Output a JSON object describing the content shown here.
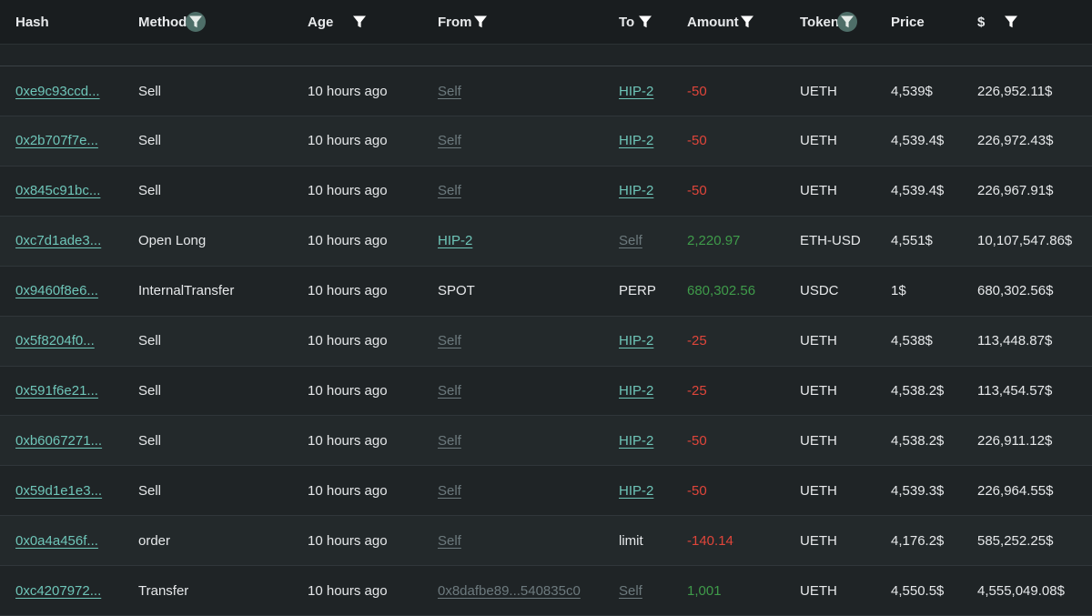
{
  "colors": {
    "link": "#6ec5b8",
    "negative": "#e0453a",
    "positive": "#3f9b4a",
    "muted": "#6d7a7e",
    "filter_active_bg": "#4e6e68"
  },
  "columns": [
    {
      "label": "Hash",
      "filter": "none"
    },
    {
      "label": "Method",
      "filter": "active"
    },
    {
      "label": "Age",
      "filter": "plain"
    },
    {
      "label": "From",
      "filter": "plain"
    },
    {
      "label": "To",
      "filter": "plain"
    },
    {
      "label": "Amount",
      "filter": "plain"
    },
    {
      "label": "Token",
      "filter": "active"
    },
    {
      "label": "Price",
      "filter": "none"
    },
    {
      "label": "$",
      "filter": "plain"
    }
  ],
  "rows": [
    {
      "hash": "0xe9c93ccd...",
      "method": "Sell",
      "age": "10 hours ago",
      "from": "Self",
      "from_style": "muted",
      "to": "HIP-2",
      "to_style": "link",
      "amount": "-50",
      "amount_sign": "neg",
      "token": "UETH",
      "price": "4,539$",
      "usd": "226,952.11$"
    },
    {
      "hash": "0x2b707f7e...",
      "method": "Sell",
      "age": "10 hours ago",
      "from": "Self",
      "from_style": "muted",
      "to": "HIP-2",
      "to_style": "link",
      "amount": "-50",
      "amount_sign": "neg",
      "token": "UETH",
      "price": "4,539.4$",
      "usd": "226,972.43$"
    },
    {
      "hash": "0x845c91bc...",
      "method": "Sell",
      "age": "10 hours ago",
      "from": "Self",
      "from_style": "muted",
      "to": "HIP-2",
      "to_style": "link",
      "amount": "-50",
      "amount_sign": "neg",
      "token": "UETH",
      "price": "4,539.4$",
      "usd": "226,967.91$"
    },
    {
      "hash": "0xc7d1ade3...",
      "method": "Open Long",
      "age": "10 hours ago",
      "from": "HIP-2",
      "from_style": "link",
      "to": "Self",
      "to_style": "muted",
      "amount": "2,220.97",
      "amount_sign": "pos",
      "token": "ETH-USD",
      "price": "4,551$",
      "usd": "10,107,547.86$"
    },
    {
      "hash": "0x9460f8e6...",
      "method": "InternalTransfer",
      "age": "10 hours ago",
      "from": "SPOT",
      "from_style": "plain",
      "to": "PERP",
      "to_style": "plain",
      "amount": "680,302.56",
      "amount_sign": "pos",
      "token": "USDC",
      "price": "1$",
      "usd": "680,302.56$"
    },
    {
      "hash": "0x5f8204f0...",
      "method": "Sell",
      "age": "10 hours ago",
      "from": "Self",
      "from_style": "muted",
      "to": "HIP-2",
      "to_style": "link",
      "amount": "-25",
      "amount_sign": "neg",
      "token": "UETH",
      "price": "4,538$",
      "usd": "113,448.87$"
    },
    {
      "hash": "0x591f6e21...",
      "method": "Sell",
      "age": "10 hours ago",
      "from": "Self",
      "from_style": "muted",
      "to": "HIP-2",
      "to_style": "link",
      "amount": "-25",
      "amount_sign": "neg",
      "token": "UETH",
      "price": "4,538.2$",
      "usd": "113,454.57$"
    },
    {
      "hash": "0xb6067271...",
      "method": "Sell",
      "age": "10 hours ago",
      "from": "Self",
      "from_style": "muted",
      "to": "HIP-2",
      "to_style": "link",
      "amount": "-50",
      "amount_sign": "neg",
      "token": "UETH",
      "price": "4,538.2$",
      "usd": "226,911.12$"
    },
    {
      "hash": "0x59d1e1e3...",
      "method": "Sell",
      "age": "10 hours ago",
      "from": "Self",
      "from_style": "muted",
      "to": "HIP-2",
      "to_style": "link",
      "amount": "-50",
      "amount_sign": "neg",
      "token": "UETH",
      "price": "4,539.3$",
      "usd": "226,964.55$"
    },
    {
      "hash": "0x0a4a456f...",
      "method": "order",
      "age": "10 hours ago",
      "from": "Self",
      "from_style": "muted",
      "to": "limit",
      "to_style": "plain",
      "amount": "-140.14",
      "amount_sign": "neg",
      "token": "UETH",
      "price": "4,176.2$",
      "usd": "585,252.25$"
    },
    {
      "hash": "0xc4207972...",
      "method": "Transfer",
      "age": "10 hours ago",
      "from": "0x8dafbe89...540835c0",
      "from_style": "muted",
      "to": "Self",
      "to_style": "muted",
      "amount": "1,001",
      "amount_sign": "pos",
      "token": "UETH",
      "price": "4,550.5$",
      "usd": "4,555,049.08$"
    }
  ]
}
